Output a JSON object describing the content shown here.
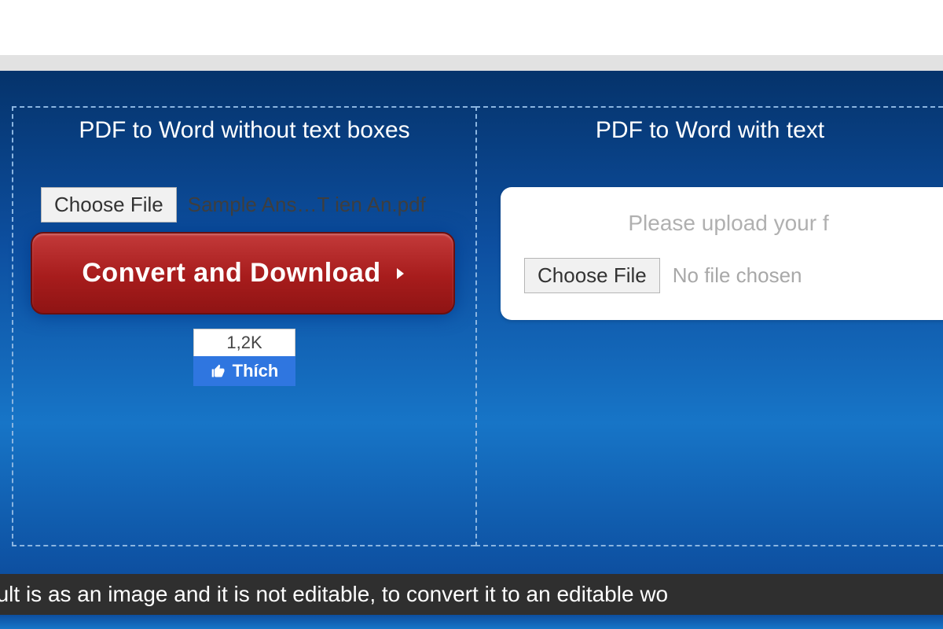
{
  "left": {
    "title": "PDF to Word without text boxes",
    "choose_label": "Choose File",
    "chosen_filename": "Sample Ans…T ien An.pdf",
    "convert_label": "Convert and Download",
    "like_count": "1,2K",
    "like_label": "Thích"
  },
  "right": {
    "title": "PDF to Word with text",
    "prompt": "Please upload your f",
    "choose_label": "Choose File",
    "no_file": "No file chosen"
  },
  "notice": "ted result is as an image and it is not editable, to convert it to an editable wo"
}
